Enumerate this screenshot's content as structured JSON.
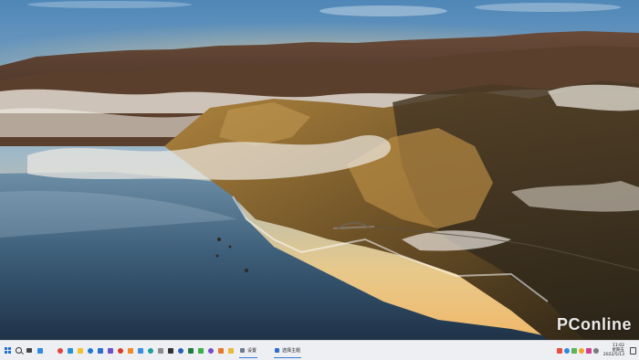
{
  "watermark": {
    "text": "PConline"
  },
  "taskbar": {
    "start_icon": "windows-start-icon",
    "search_icon": "search-icon",
    "task_view_icon": "task-view-icon",
    "widgets_icon": "widgets-icon",
    "apps": [
      {
        "name": "app-chrome-icon",
        "color": "#e2453c"
      },
      {
        "name": "app-edge-icon",
        "color": "#2a8fd6"
      },
      {
        "name": "app-explorer-icon",
        "color": "#f2c230"
      },
      {
        "name": "app-store-icon",
        "color": "#1e78d2"
      },
      {
        "name": "app-mail-icon",
        "color": "#2f6ecb"
      },
      {
        "name": "app-media-icon",
        "color": "#6a52c8"
      },
      {
        "name": "app-red-icon",
        "color": "#d83b2d"
      },
      {
        "name": "app-orange-icon",
        "color": "#f08a24"
      },
      {
        "name": "app-blue-icon",
        "color": "#3a8de0"
      },
      {
        "name": "app-teal-icon",
        "color": "#1fa09a"
      },
      {
        "name": "app-gray-icon",
        "color": "#8c8c8c"
      },
      {
        "name": "app-dark-icon",
        "color": "#333333"
      },
      {
        "name": "app-word-icon",
        "color": "#2b5fb8"
      },
      {
        "name": "app-excel-icon",
        "color": "#1e7b45"
      },
      {
        "name": "app-green-icon",
        "color": "#3fae49"
      },
      {
        "name": "app-purple-icon",
        "color": "#7b4bc4"
      },
      {
        "name": "app-orange2-icon",
        "color": "#e8762b"
      },
      {
        "name": "app-folder-icon",
        "color": "#e9b93a"
      }
    ],
    "windows": [
      {
        "label": "设置",
        "icon_color": "#6b7a8c",
        "active": true
      },
      {
        "label": "选择主题",
        "icon_color": "#2f6ecb",
        "active": true
      }
    ],
    "tray": [
      {
        "name": "tray-icon-1",
        "color": "#e84d3d"
      },
      {
        "name": "tray-icon-2",
        "color": "#2f8ae0"
      },
      {
        "name": "tray-icon-3",
        "color": "#5ab552"
      },
      {
        "name": "tray-icon-4",
        "color": "#f2a32e"
      },
      {
        "name": "tray-icon-5",
        "color": "#d43f8d"
      },
      {
        "name": "tray-icon-6",
        "color": "#7a7a7a"
      }
    ],
    "clock": {
      "time": "11:02",
      "day": "星期五",
      "date": "2022/5/13"
    }
  }
}
